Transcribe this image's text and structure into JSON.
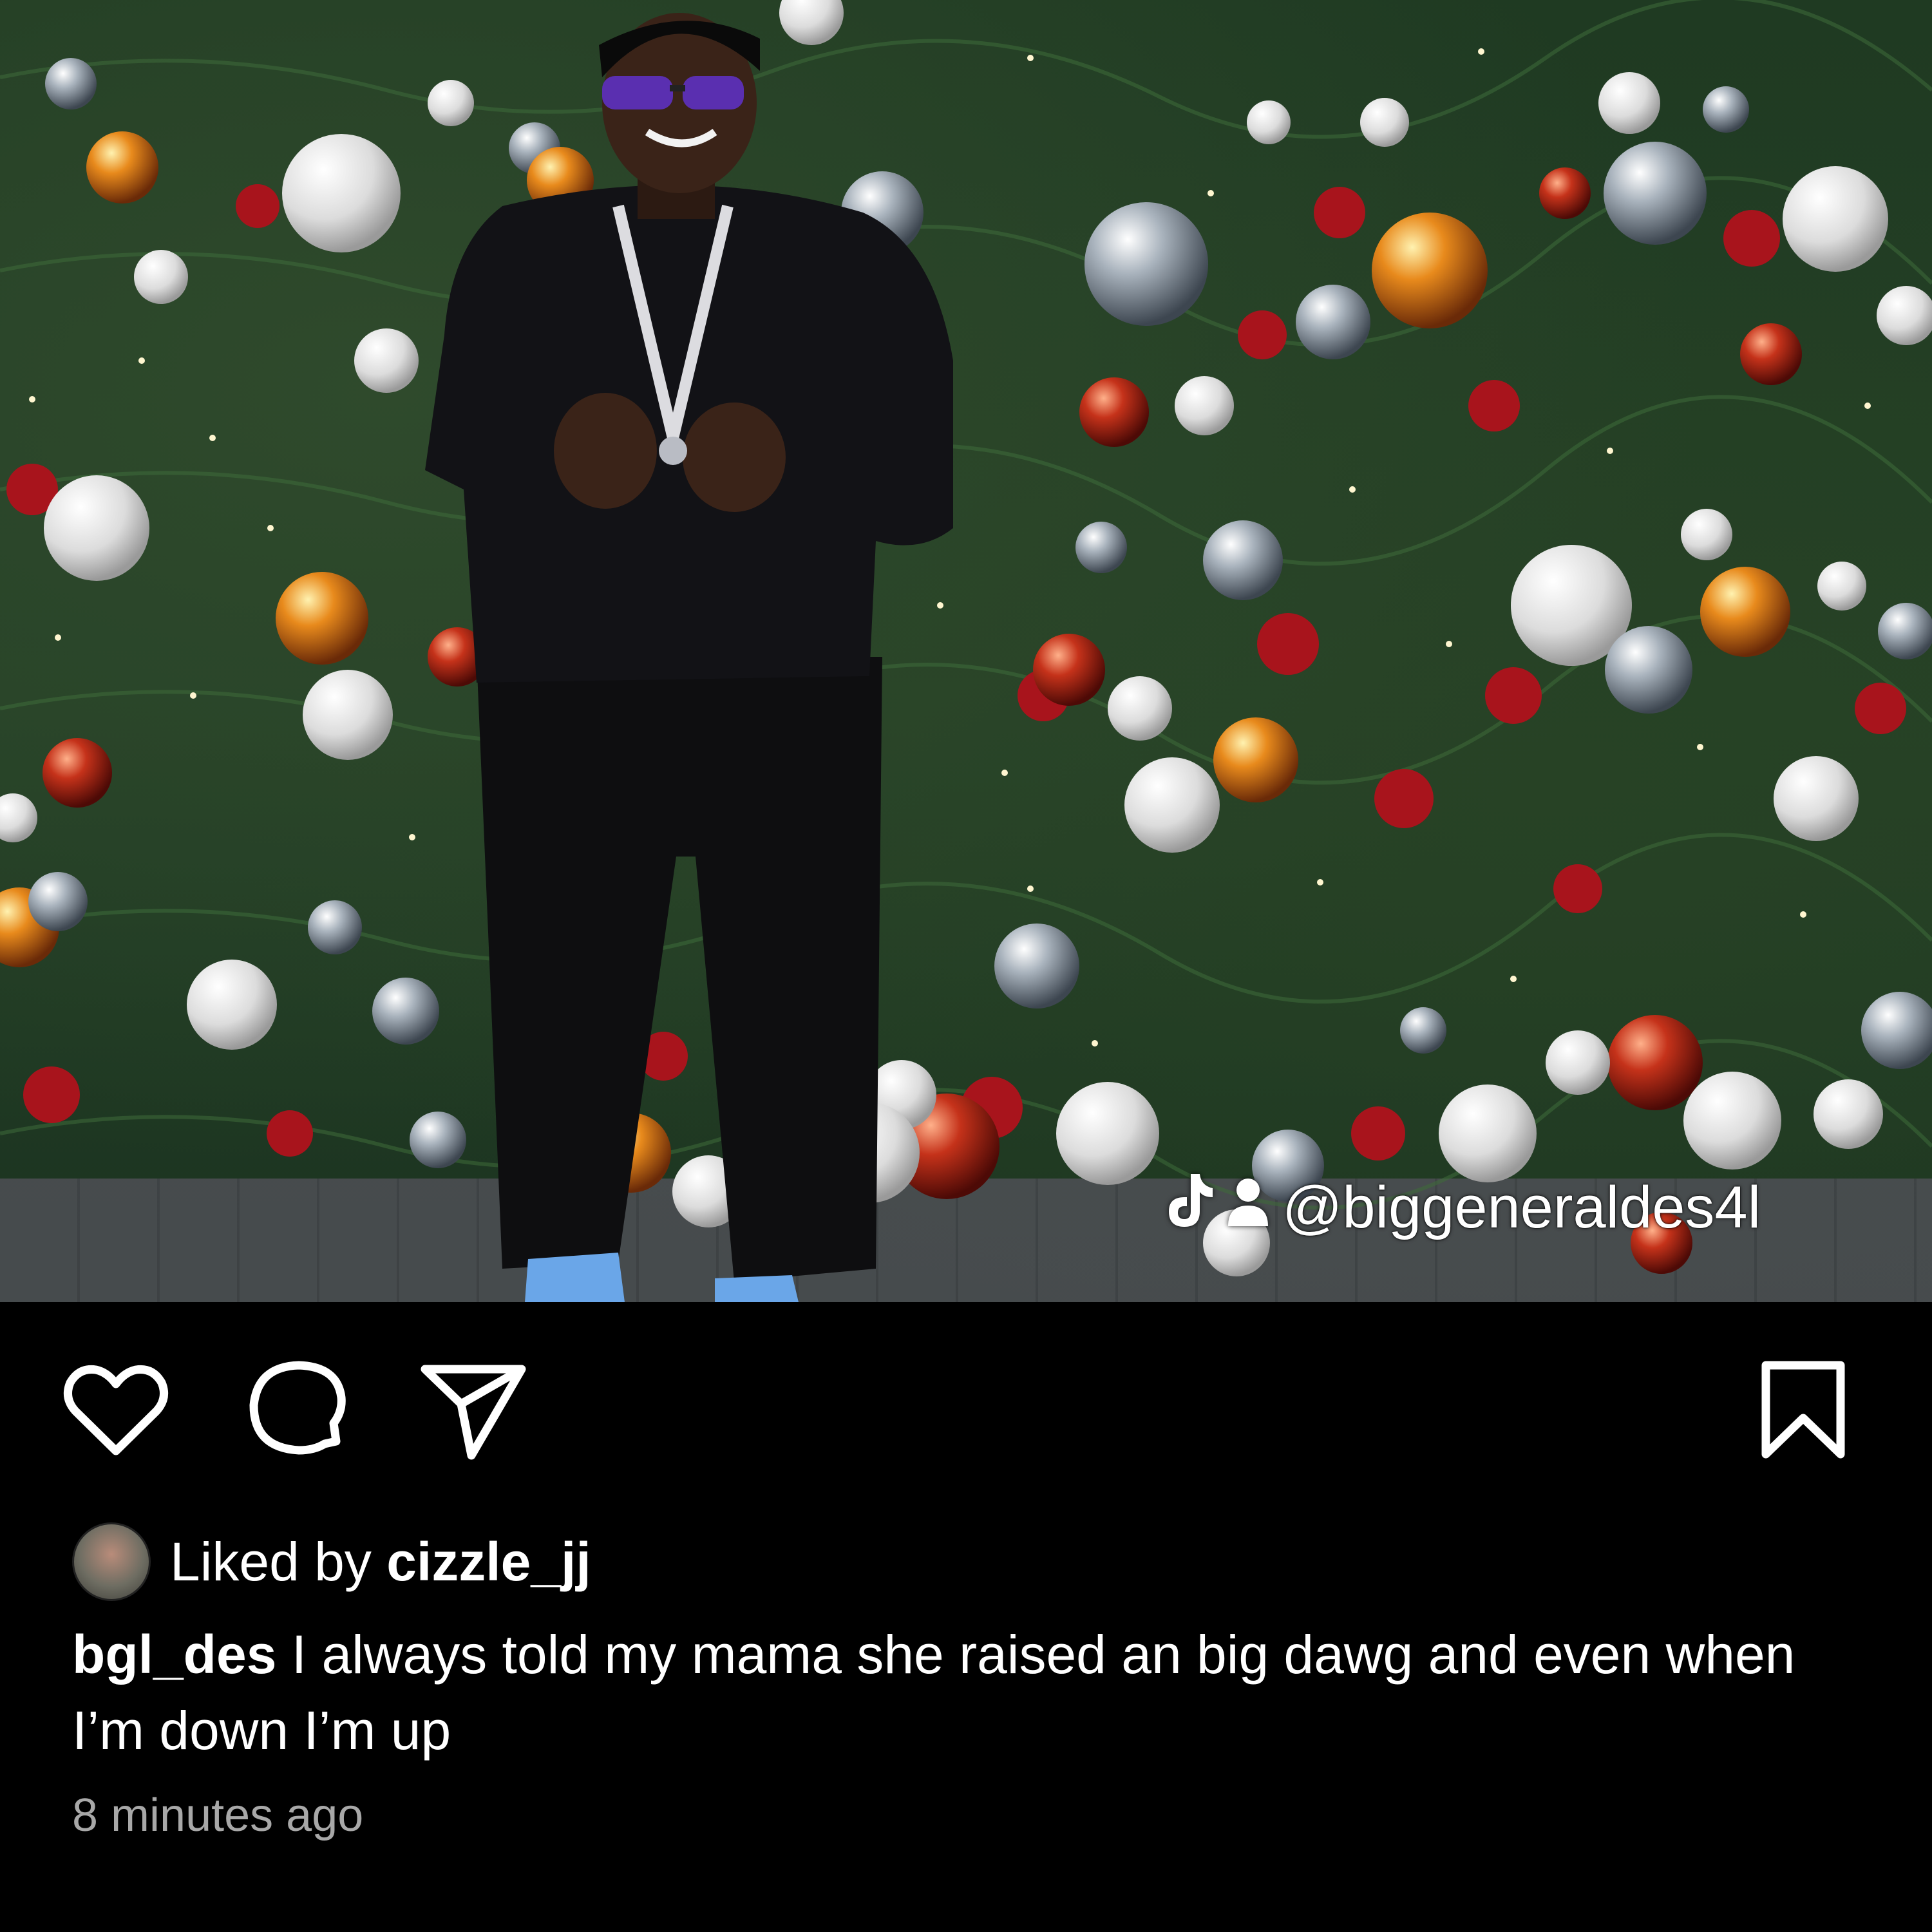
{
  "post": {
    "watermark_handle": "@biggeneraldes4l",
    "liked_by_prefix": "Liked by",
    "liked_by_user": "cizzle_jj",
    "caption_user": "bgl_des",
    "caption_text": "I always told my mama she raised an big dawg and even when I’m down I’m up",
    "timestamp": "8 minutes ago"
  },
  "icons": {
    "like": "heart-icon",
    "comment": "comment-icon",
    "share": "send-icon",
    "save": "bookmark-icon",
    "watermark": [
      "tiktok-icon",
      "person-icon"
    ]
  },
  "colors": {
    "background": "#000000",
    "text": "#ffffff",
    "timestamp": "#a8a8a8"
  }
}
